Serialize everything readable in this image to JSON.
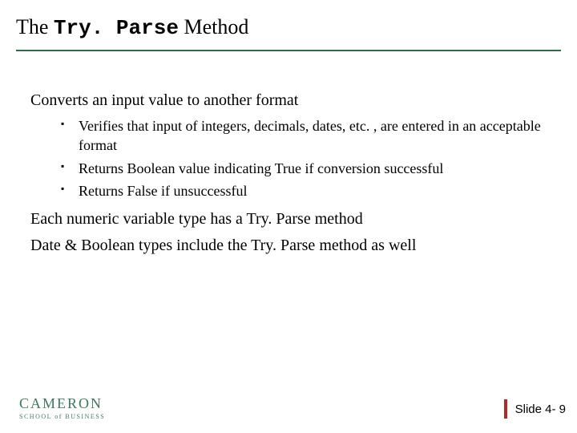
{
  "title": {
    "pre": "The ",
    "code": "Try. Parse",
    "post": " Method"
  },
  "points": {
    "p1": "Converts an input value to another format",
    "p1_sub": [
      "Verifies that input of integers, decimals, dates, etc. , are entered in an acceptable format",
      "Returns Boolean value indicating True if conversion successful",
      "Returns False if unsuccessful"
    ],
    "p2": "Each numeric variable type has a Try. Parse method",
    "p3": "Date & Boolean types include the Try. Parse method as well"
  },
  "footer": {
    "brand": "CAMERON",
    "subbrand": "SCHOOL of BUSINESS",
    "slide_label": "Slide 4- 9"
  }
}
